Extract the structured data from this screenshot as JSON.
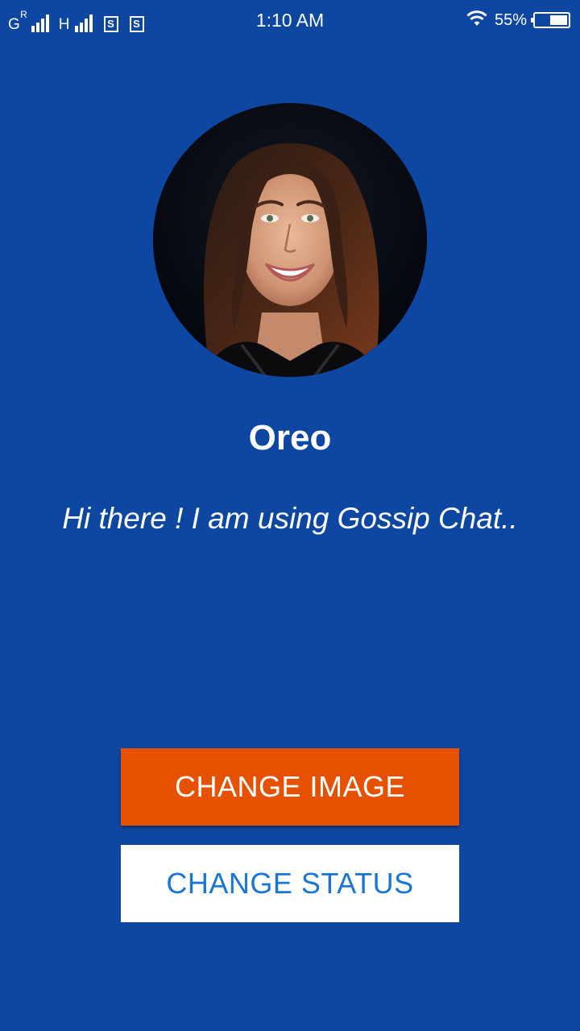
{
  "status_bar": {
    "network_1": "G",
    "network_1_roaming": "R",
    "network_2": "H",
    "sim_1": "S",
    "sim_2": "S",
    "time": "1:10 AM",
    "battery_percent": "55%",
    "battery_level": 0.55,
    "icons": [
      "signal-icon",
      "signal-icon",
      "sim-icon",
      "sim-icon",
      "wifi-icon",
      "battery-icon"
    ]
  },
  "profile": {
    "name": "Oreo",
    "status": "Hi there ! I am using Gossip Chat.."
  },
  "actions": {
    "change_image_label": "CHANGE IMAGE",
    "change_status_label": "CHANGE STATUS"
  },
  "colors": {
    "background": "#0e47a1",
    "change_image_button": "#e65100",
    "change_status_button": "#ffffff",
    "change_status_text": "#1976d2"
  }
}
